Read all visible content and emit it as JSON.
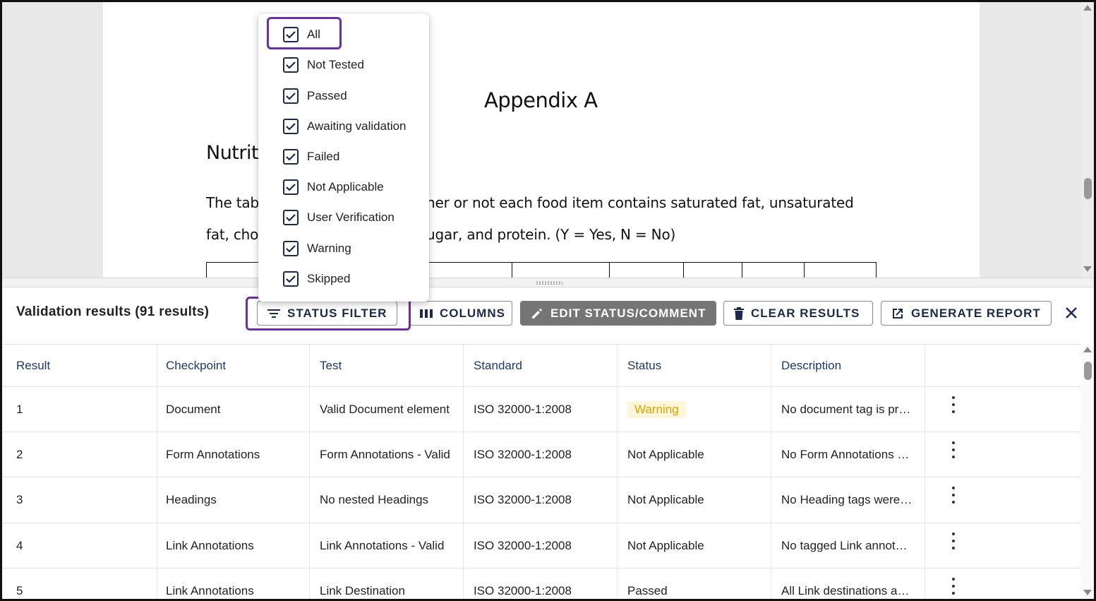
{
  "document": {
    "title": "Appendix A",
    "heading_partial": "Nutrit",
    "line1_start": "The tab",
    "line1_end": "her or not each food item contains saturated fat, unsaturated",
    "line2_start": "fat, cho",
    "line2_end": "ugar, and protein.  (Y = Yes, N = No)"
  },
  "status_filter_menu": {
    "options": [
      {
        "label": "All",
        "checked": true
      },
      {
        "label": "Not Tested",
        "checked": true
      },
      {
        "label": "Passed",
        "checked": true
      },
      {
        "label": "Awaiting validation",
        "checked": true
      },
      {
        "label": "Failed",
        "checked": true
      },
      {
        "label": "Not Applicable",
        "checked": true
      },
      {
        "label": "User Verification",
        "checked": true
      },
      {
        "label": "Warning",
        "checked": true
      },
      {
        "label": "Skipped",
        "checked": true
      }
    ]
  },
  "panel": {
    "title": "Validation results (91 results)",
    "buttons": {
      "status_filter": "STATUS FILTER",
      "columns": "COLUMNS",
      "edit_status": "EDIT STATUS/COMMENT",
      "clear_results": "CLEAR RESULTS",
      "generate_report": "GENERATE REPORT"
    }
  },
  "table": {
    "headers": [
      "Result",
      "Checkpoint",
      "Test",
      "Standard",
      "Status",
      "Description"
    ],
    "rows": [
      {
        "result": "1",
        "checkpoint": "Document",
        "test": "Valid Document element",
        "standard": "ISO 32000-1:2008",
        "status": "Warning",
        "description": "No document tag is present"
      },
      {
        "result": "2",
        "checkpoint": "Form Annotations",
        "test": "Form Annotations - Valid",
        "standard": "ISO 32000-1:2008",
        "status": "Not Applicable",
        "description": "No Form Annotations were found"
      },
      {
        "result": "3",
        "checkpoint": "Headings",
        "test": "No nested Headings",
        "standard": "ISO 32000-1:2008",
        "status": "Not Applicable",
        "description": "No Heading tags were found"
      },
      {
        "result": "4",
        "checkpoint": "Link Annotations",
        "test": "Link Annotations - Valid",
        "standard": "ISO 32000-1:2008",
        "status": "Not Applicable",
        "description": "No tagged Link annotations"
      },
      {
        "result": "5",
        "checkpoint": "Link Annotations",
        "test": "Link Destination",
        "standard": "ISO 32000-1:2008",
        "status": "Passed",
        "description": "All Link destinations are valid"
      }
    ]
  },
  "colors": {
    "highlight": "#6b2fa0",
    "warning_text": "#e0a000",
    "warning_bg": "#fdf6d8",
    "header_text": "#1b3a6b"
  }
}
